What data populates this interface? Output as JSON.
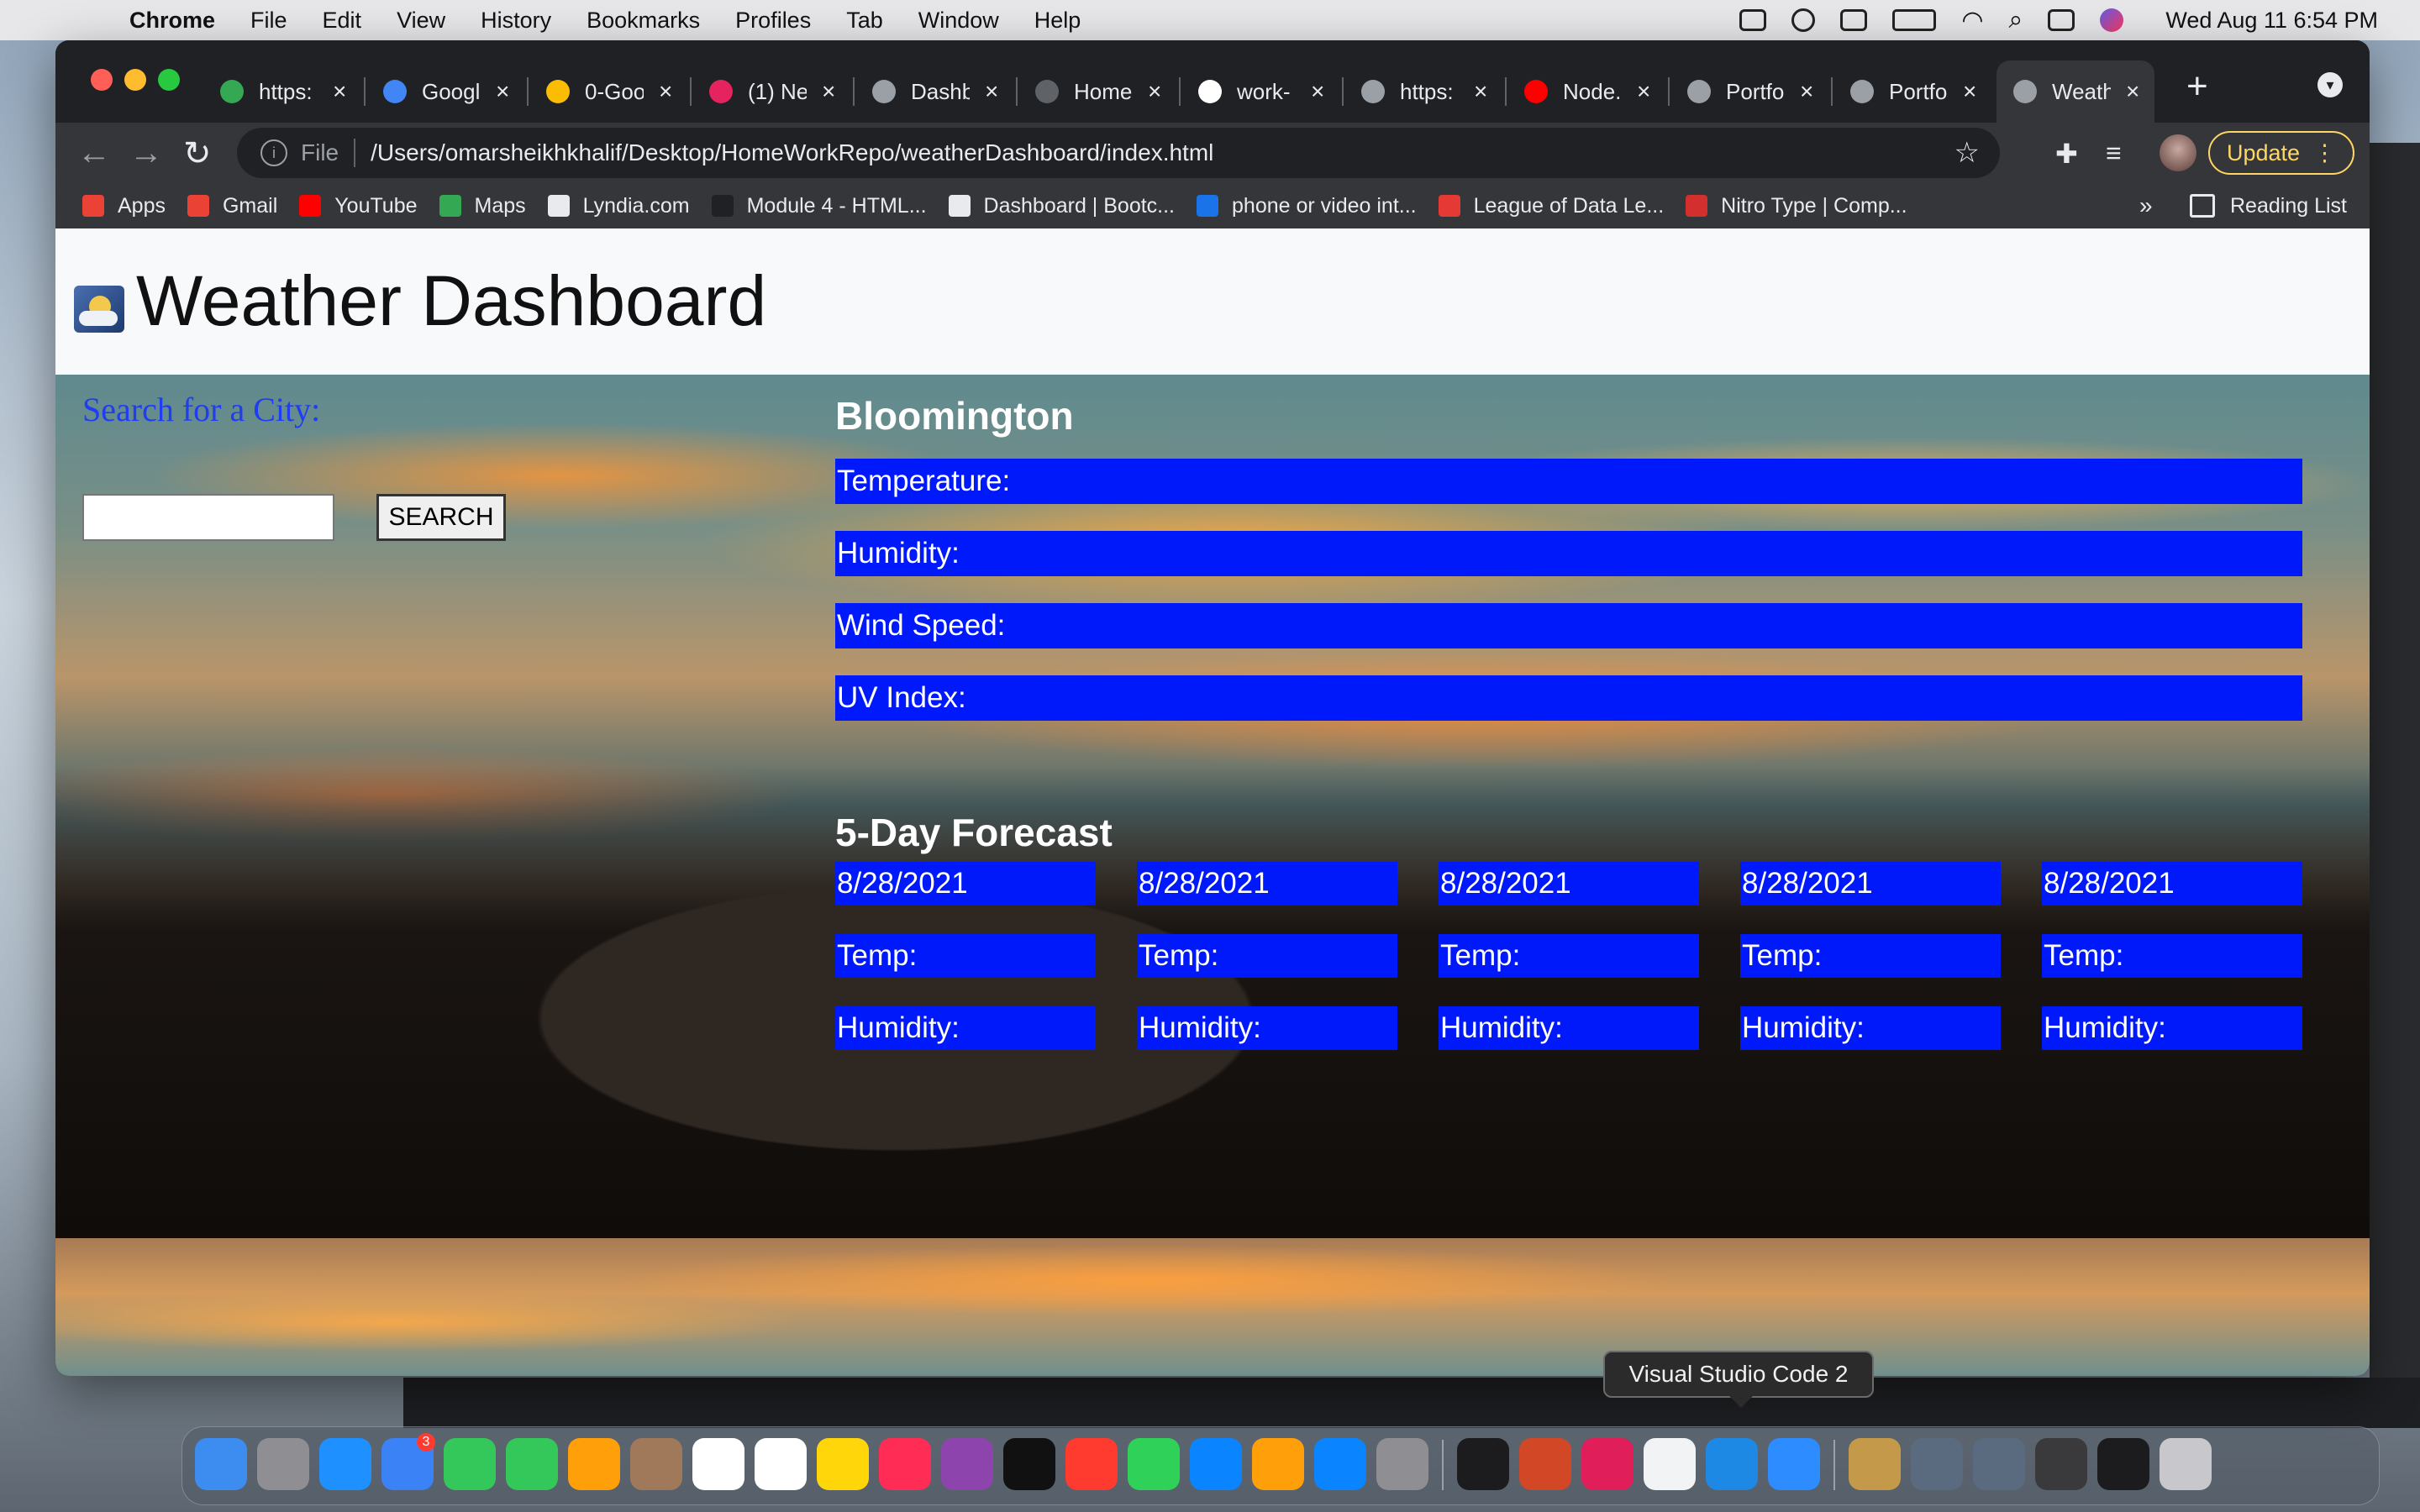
{
  "menubar": {
    "app_name": "Chrome",
    "menus": [
      "File",
      "Edit",
      "View",
      "History",
      "Bookmarks",
      "Profiles",
      "Tab",
      "Window",
      "Help"
    ],
    "clock": "Wed Aug 11  6:54 PM"
  },
  "tabs": [
    {
      "title": "https:",
      "favicon_color": "#34a853"
    },
    {
      "title": "Googl",
      "favicon_color": "#4285f4"
    },
    {
      "title": "0-Goo",
      "favicon_color": "#fbbc04"
    },
    {
      "title": "(1) Ne",
      "favicon_color": "#e5235f"
    },
    {
      "title": "Dashb",
      "favicon_color": "#9aa0a6"
    },
    {
      "title": "Home",
      "favicon_color": "#5f6368"
    },
    {
      "title": "work-",
      "favicon_color": "#ffffff"
    },
    {
      "title": "https:",
      "favicon_color": "#9aa0a6"
    },
    {
      "title": "Node.",
      "favicon_color": "#ff0000"
    },
    {
      "title": "Portfo",
      "favicon_color": "#9aa0a6"
    },
    {
      "title": "Portfo",
      "favicon_color": "#9aa0a6"
    },
    {
      "title": "Weath",
      "favicon_color": "#9aa0a6",
      "active": true
    }
  ],
  "omnibox": {
    "protocol": "File",
    "url": "/Users/omarsheikhkhalif/Desktop/HomeWorkRepo/weatherDashboard/index.html"
  },
  "toolbar": {
    "update_label": "Update"
  },
  "bookmarks": [
    {
      "label": "Apps",
      "icon_color": "#ea4335"
    },
    {
      "label": "Gmail",
      "icon_color": "#ea4335"
    },
    {
      "label": "YouTube",
      "icon_color": "#ff0000"
    },
    {
      "label": "Maps",
      "icon_color": "#34a853"
    },
    {
      "label": "Lyndia.com",
      "icon_color": "#e8eaed"
    },
    {
      "label": "Module 4 - HTML...",
      "icon_color": "#202124"
    },
    {
      "label": "Dashboard | Bootc...",
      "icon_color": "#e8eaed"
    },
    {
      "label": "phone or video int...",
      "icon_color": "#1a73e8"
    },
    {
      "label": "League of Data Le...",
      "icon_color": "#e53935"
    },
    {
      "label": "Nitro Type | Comp...",
      "icon_color": "#d32f2f"
    }
  ],
  "bookmarks_more": "»",
  "reading_list": "Reading List",
  "page": {
    "title": "Weather Dashboard",
    "search_label": "Search for a City:",
    "search_value": "",
    "search_button": "SEARCH",
    "city": "Bloomington",
    "current": {
      "temperature": "Temperature:",
      "humidity": "Humidity:",
      "wind": "Wind Speed:",
      "uv": "UV Index:"
    },
    "forecast_title": "5-Day Forecast",
    "forecast": [
      {
        "date": "8/28/2021",
        "temp": "Temp:",
        "humidity": "Humidity:"
      },
      {
        "date": "8/28/2021",
        "temp": "Temp:",
        "humidity": "Humidity:"
      },
      {
        "date": "8/28/2021",
        "temp": "Temp:",
        "humidity": "Humidity:"
      },
      {
        "date": "8/28/2021",
        "temp": "Temp:",
        "humidity": "Humidity:"
      },
      {
        "date": "8/28/2021",
        "temp": "Temp:",
        "humidity": "Humidity:"
      }
    ]
  },
  "tooltip": "Visual Studio Code 2",
  "dock": {
    "badge": "3",
    "icons": [
      "finder-icon",
      "launchpad-icon",
      "safari-icon",
      "mail-icon",
      "messages-icon",
      "maps-icon",
      "photos-icon",
      "contacts-icon",
      "calendar-icon",
      "reminders-icon",
      "notes-icon",
      "music-icon",
      "podcasts-icon",
      "tv-icon",
      "news-icon",
      "numbers-icon",
      "keynote-icon",
      "pages-icon",
      "app-store-icon",
      "system-preferences-icon",
      "terminal-icon",
      "powerpoint-icon",
      "slack-icon",
      "chrome-icon",
      "vscode-icon",
      "zoom-icon",
      "folder-icon",
      "window-thumb-1",
      "window-thumb-2",
      "window-thumb-3",
      "window-thumb-4",
      "trash-icon"
    ]
  }
}
